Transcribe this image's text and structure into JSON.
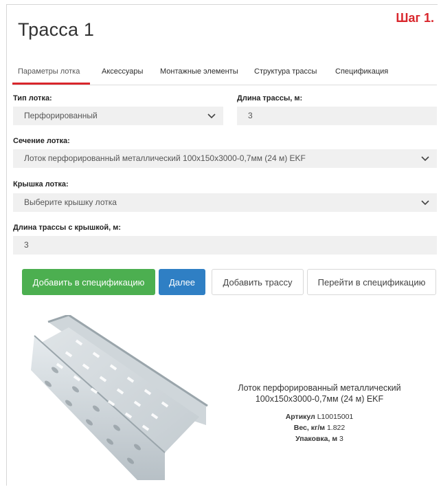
{
  "header": {
    "title": "Трасса 1",
    "step": "Шаг 1."
  },
  "tabs": [
    {
      "label": "Параметры лотка",
      "active": true
    },
    {
      "label": "Аксессуары"
    },
    {
      "label": "Монтажные элементы"
    },
    {
      "label": "Структура трассы"
    },
    {
      "label": "Спецификация"
    }
  ],
  "form": {
    "tray_type": {
      "label": "Тип лотка:",
      "value": "Перфорированный"
    },
    "route_length": {
      "label": "Длина трассы, м:",
      "value": "3"
    },
    "tray_section": {
      "label": "Сечение лотка:",
      "value": "Лоток перфорированный металлический 100x150x3000-0,7мм (24 м) EKF"
    },
    "tray_cover": {
      "label": "Крышка лотка:",
      "value": "Выберите крышку лотка"
    },
    "route_length_cover": {
      "label": "Длина трассы с крышкой, м:",
      "value": "3"
    }
  },
  "buttons": {
    "add_to_spec": "Добавить в спецификацию",
    "next": "Далее",
    "add_route": "Добавить трассу",
    "go_to_spec": "Перейти в спецификацию"
  },
  "product": {
    "name_line1": "Лоток перфорированный металлический",
    "name_line2": "100x150x3000-0,7мм (24 м) EKF",
    "article_label": "Артикул",
    "article_value": "L10015001",
    "weight_label": "Вес, кг/м",
    "weight_value": "1.822",
    "pack_label": "Упаковка, м",
    "pack_value": "3"
  },
  "colors": {
    "accent_red": "#d9262c",
    "green": "#4caf50",
    "blue": "#2f7fc4"
  }
}
